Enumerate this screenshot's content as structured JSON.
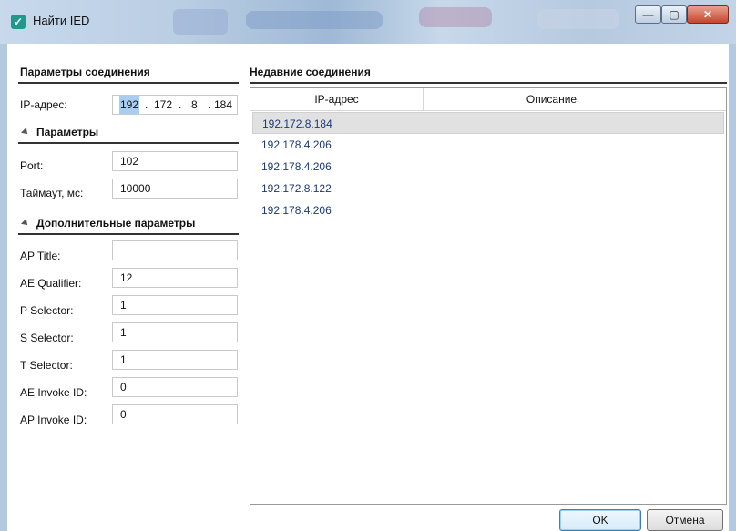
{
  "window": {
    "title": "Найти IED",
    "icon": "app-icon",
    "controls": {
      "minimize": "—",
      "maximize": "▢",
      "close": "✕"
    }
  },
  "connection": {
    "heading": "Параметры соединения",
    "ip_label": "IP-адрес:",
    "ip_octets": [
      "192",
      "172",
      "8",
      "184"
    ],
    "ip_dot": "."
  },
  "params": {
    "heading": "Параметры",
    "port_label": "Port:",
    "port_value": "102",
    "timeout_label": "Таймаут, мс:",
    "timeout_value": "10000"
  },
  "advanced": {
    "heading": "Дополнительные параметры",
    "fields": [
      {
        "label": "AP Title:",
        "value": ""
      },
      {
        "label": "AE Qualifier:",
        "value": "12"
      },
      {
        "label": "P Selector:",
        "value": "1"
      },
      {
        "label": "S Selector:",
        "value": "1"
      },
      {
        "label": "T Selector:",
        "value": "1"
      },
      {
        "label": "AE Invoke ID:",
        "value": "0"
      },
      {
        "label": "AP Invoke ID:",
        "value": "0"
      }
    ]
  },
  "recent": {
    "heading": "Недавние соединения",
    "columns": [
      "IP-адрес",
      "Описание"
    ],
    "rows": [
      {
        "ip": "192.172.8.184",
        "desc": "",
        "selected": true
      },
      {
        "ip": "192.178.4.206",
        "desc": ""
      },
      {
        "ip": "192.178.4.206",
        "desc": ""
      },
      {
        "ip": "192.172.8.122",
        "desc": ""
      },
      {
        "ip": "192.178.4.206",
        "desc": ""
      }
    ]
  },
  "buttons": {
    "ok": "OK",
    "cancel": "Отмена"
  }
}
